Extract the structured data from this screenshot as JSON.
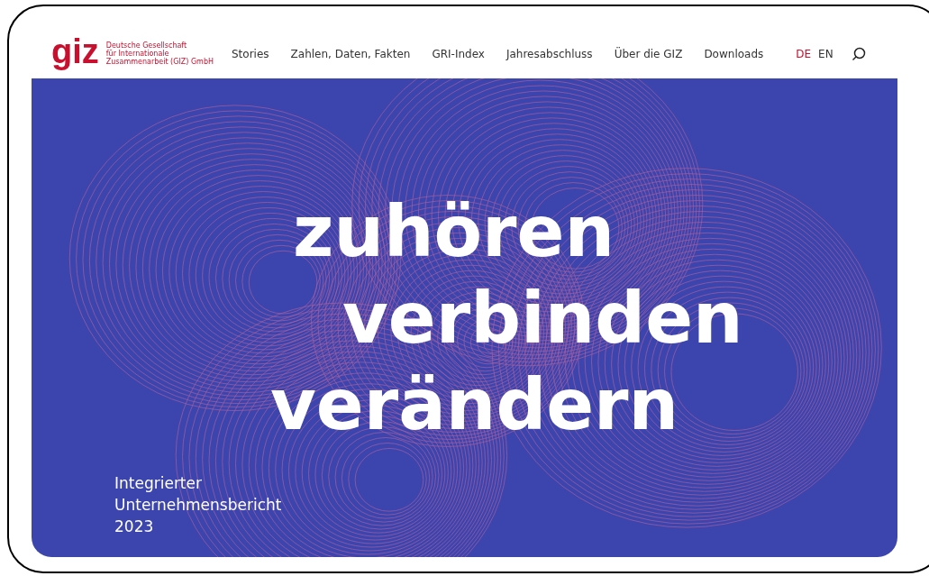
{
  "logo": {
    "mark": "giz",
    "lines": [
      "Deutsche Gesellschaft",
      "für Internationale",
      "Zusammenarbeit (GIZ) GmbH"
    ]
  },
  "nav": [
    "Stories",
    "Zahlen, Daten, Fakten",
    "GRI-Index",
    "Jahresabschluss",
    "Über die GIZ",
    "Downloads"
  ],
  "languages": [
    {
      "label": "DE",
      "selected": true
    },
    {
      "label": "EN",
      "selected": false
    }
  ],
  "hero": {
    "headline": [
      "zuhören",
      "verbinden",
      "verändern"
    ],
    "subtitle": [
      "Integrierter",
      "Unternehmensbericht",
      "2023"
    ]
  }
}
